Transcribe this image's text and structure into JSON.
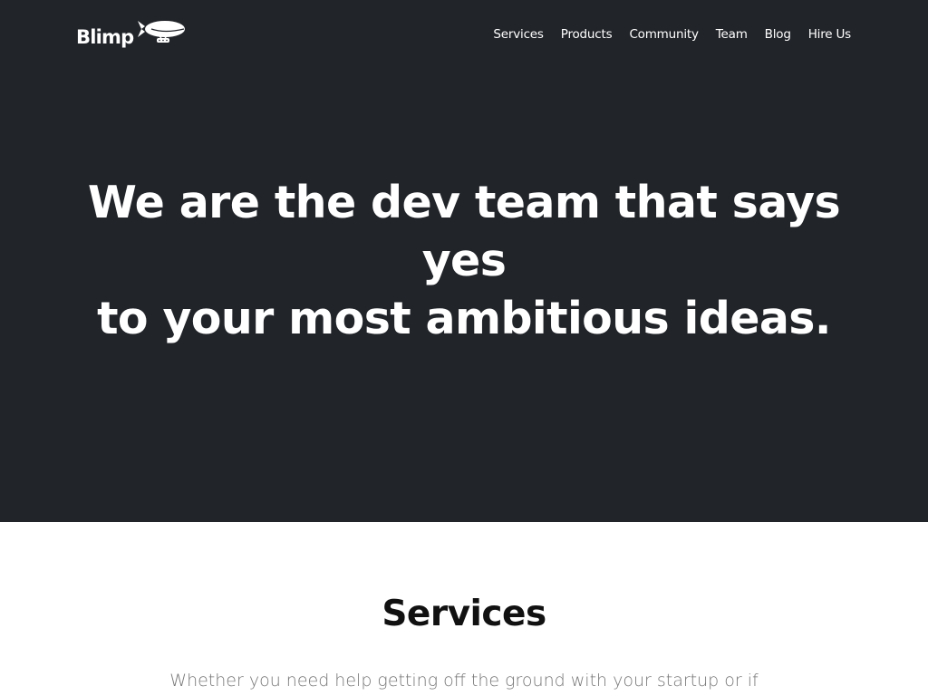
{
  "navbar": {
    "logo_text": "Blimp",
    "links": [
      {
        "label": "Services"
      },
      {
        "label": "Products"
      },
      {
        "label": "Community"
      },
      {
        "label": "Team"
      },
      {
        "label": "Blog"
      },
      {
        "label": "Hire Us"
      }
    ]
  },
  "hero": {
    "title_line1": "We are the dev team that says yes",
    "title_line2": "to your most ambitious ideas."
  },
  "services": {
    "title": "Services",
    "lead": "Whether you need help getting off the ground with your startup or if"
  },
  "colors": {
    "hero_background": "#212429",
    "text_light": "#ffffff",
    "heading_dark": "#111111",
    "muted_text": "#767676"
  },
  "icons": {
    "logo_mark": "blimp-icon"
  }
}
